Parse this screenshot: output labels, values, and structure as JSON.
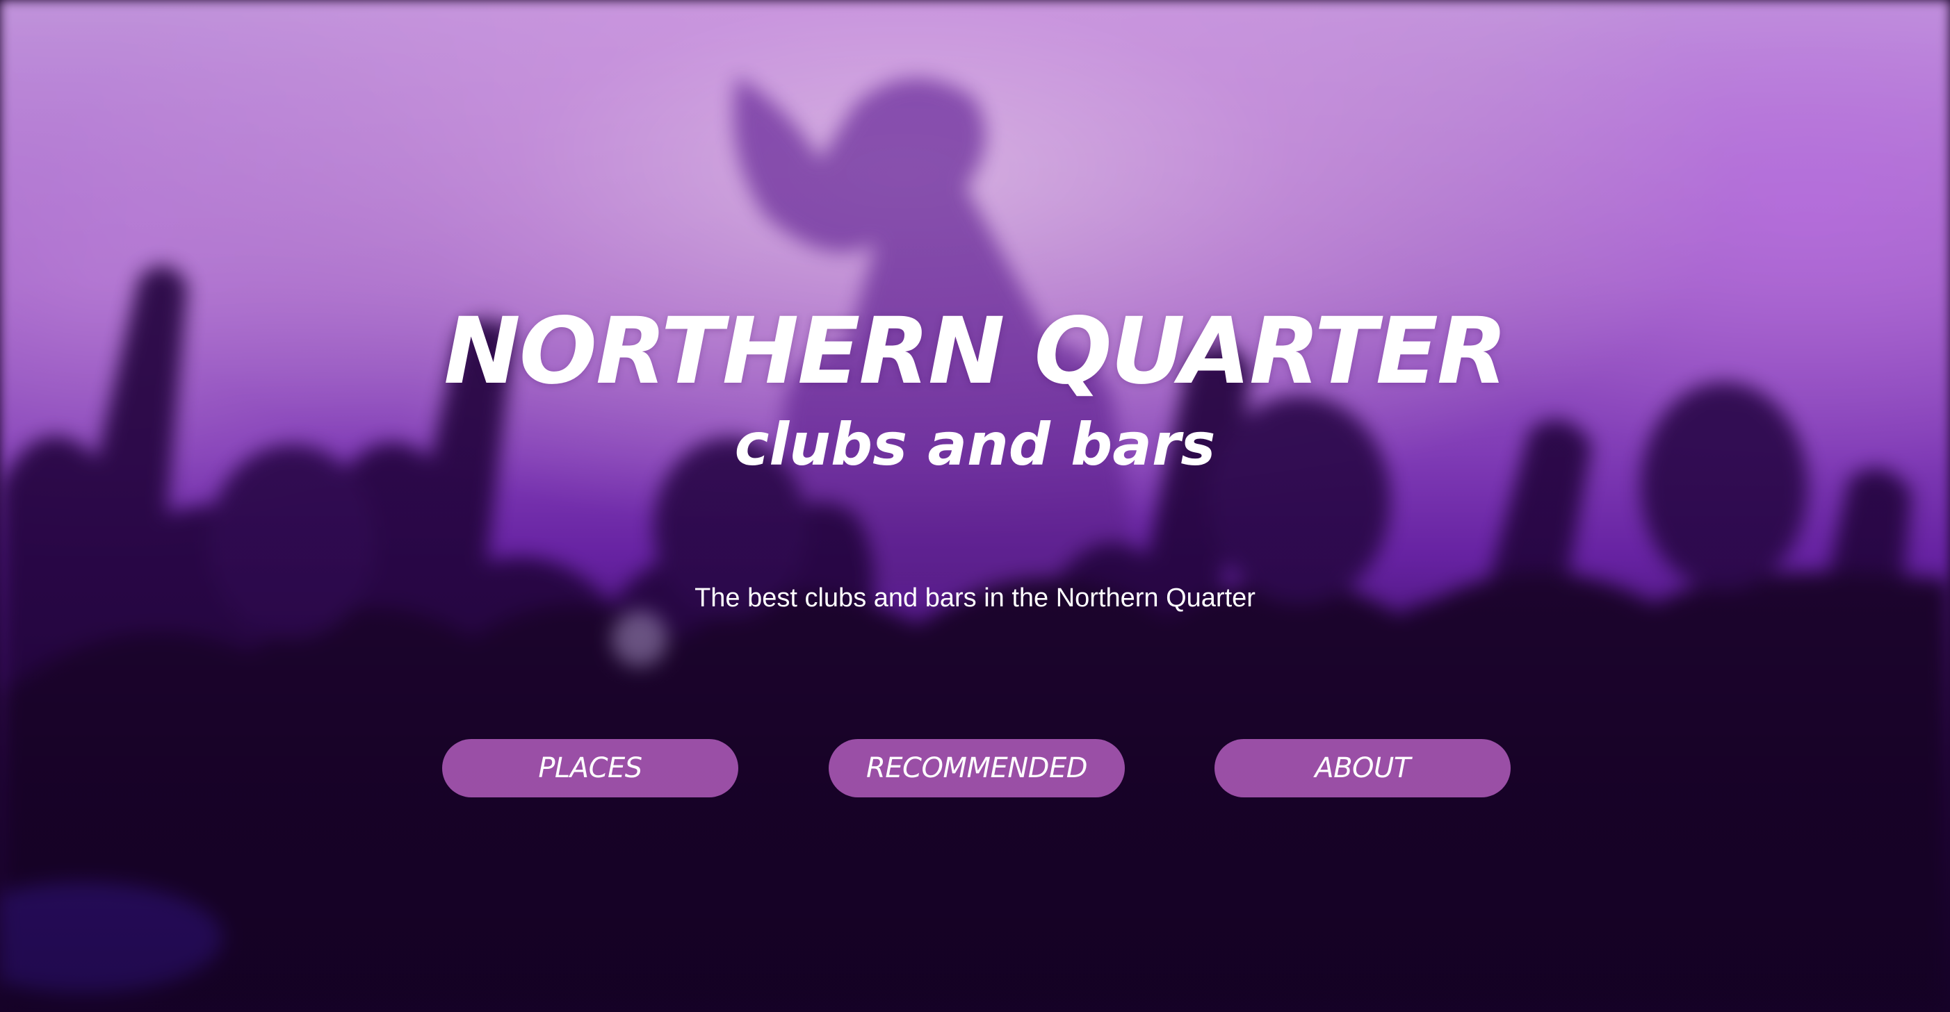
{
  "hero": {
    "title": "NORTHERN QUARTER",
    "subtitle": "clubs and bars",
    "tagline": "The best clubs and bars in the Northern Quarter",
    "background_icon": "concert-crowd-photo"
  },
  "nav": {
    "items": [
      {
        "label": "PLACES"
      },
      {
        "label": "RECOMMENDED"
      },
      {
        "label": "ABOUT"
      }
    ]
  },
  "colors": {
    "text": "#ffffff",
    "button_bg": "#cd6ed7",
    "background_light": "#d6a0e8",
    "background_dark": "#1b0530"
  }
}
